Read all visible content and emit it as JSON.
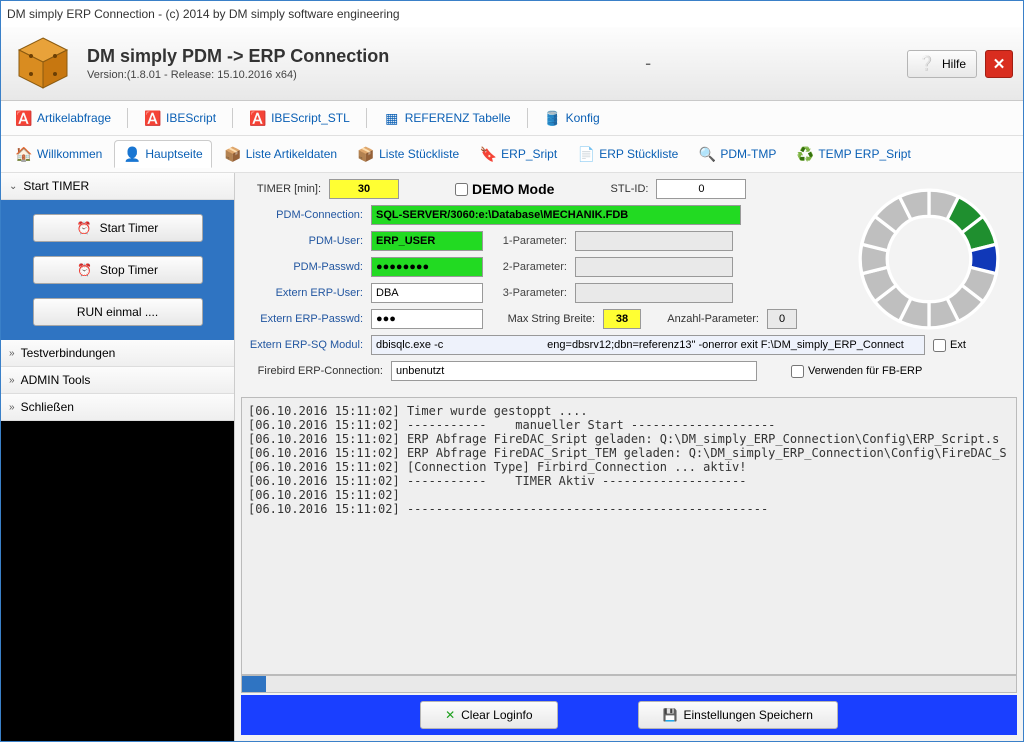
{
  "window": {
    "title": "DM simply ERP Connection - (c) 2014 by DM simply software engineering"
  },
  "header": {
    "title": "DM simply PDM  ->  ERP Connection",
    "version": "Version:(1.8.01 - Release: 15.10.2016 x64)",
    "help_label": "Hilfe",
    "dash": "-"
  },
  "toolbar1": {
    "items": [
      "Artikelabfrage",
      "IBEScript",
      "IBEScript_STL",
      "REFERENZ Tabelle",
      "Konfig"
    ]
  },
  "toolbar2": {
    "items": [
      "Willkommen",
      "Hauptseite",
      "Liste Artikeldaten",
      "Liste Stückliste",
      "ERP_Sript",
      "ERP Stückliste",
      "PDM-TMP",
      "TEMP ERP_Sript"
    ],
    "active_index": 1
  },
  "sidebar": {
    "sections": [
      "Start TIMER",
      "Testverbindungen",
      "ADMIN Tools",
      "Schließen"
    ],
    "start_timer": "Start Timer",
    "stop_timer": "Stop Timer",
    "run_once": "RUN einmal ...."
  },
  "form": {
    "timer_label": "TIMER [min]:",
    "timer_value": "30",
    "demo_label": "DEMO Mode",
    "stl_id_label": "STL-ID:",
    "stl_id_value": "0",
    "pdm_conn_label": "PDM-Connection:",
    "pdm_conn_value": "SQL-SERVER/3060:e:\\Database\\MECHANIK.FDB",
    "pdm_user_label": "PDM-User:",
    "pdm_user_value": "ERP_USER",
    "pdm_pw_label": "PDM-Passwd:",
    "pdm_pw_value": "●●●●●●●●",
    "erp_user_label": "Extern ERP-User:",
    "erp_user_value": "DBA",
    "erp_pw_label": "Extern ERP-Passwd:",
    "erp_pw_value": "●●●",
    "p1_label": "1-Parameter:",
    "p2_label": "2-Parameter:",
    "p3_label": "3-Parameter:",
    "maxstr_label": "Max String Breite:",
    "maxstr_value": "38",
    "anz_label": "Anzahl-Parameter:",
    "anz_value": "0",
    "sq_label": "Extern ERP-SQ Modul:",
    "sq_value": "dbisqlc.exe -c                                  eng=dbsrv12;dbn=referenz13\" -onerror exit F:\\DM_simply_ERP_Connect",
    "ext_label": "Ext",
    "fb_conn_label": "Firebird ERP-Connection:",
    "fb_conn_value": "unbenutzt",
    "use_fb_label": "Verwenden für FB-ERP"
  },
  "log_lines": [
    "[06.10.2016 15:11:02] Timer wurde gestoppt ....",
    "[06.10.2016 15:11:02] -----------    manueller Start --------------------",
    "[06.10.2016 15:11:02] ERP Abfrage FireDAC_Sript geladen: Q:\\DM_simply_ERP_Connection\\Config\\ERP_Script.s",
    "[06.10.2016 15:11:02] ERP Abfrage FireDAC_Sript_TEM geladen: Q:\\DM_simply_ERP_Connection\\Config\\FireDAC_S",
    "[06.10.2016 15:11:02] [Connection Type] Firbird_Connection ... aktiv!",
    "[06.10.2016 15:11:02] -----------    TIMER Aktiv --------------------",
    "[06.10.2016 15:11:02]",
    "[06.10.2016 15:11:02] --------------------------------------------------"
  ],
  "footer": {
    "clear": "Clear Loginfo",
    "save": "Einstellungen Speichern"
  }
}
